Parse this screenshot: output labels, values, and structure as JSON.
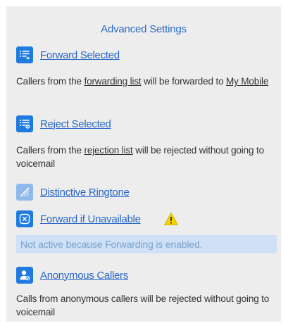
{
  "header": {
    "title": "Advanced Settings"
  },
  "forward_selected": {
    "label": "Forward Selected",
    "desc_before": "Callers from the ",
    "desc_link": "forwarding list",
    "desc_middle": " will be forwarded to ",
    "desc_target": "My Mobile",
    "icon": "list-forward-icon"
  },
  "reject_selected": {
    "label": "Reject Selected",
    "desc_before": "Callers from the ",
    "desc_link": "rejection list",
    "desc_after": " will be rejected without going to voicemail",
    "icon": "list-reject-icon"
  },
  "distinctive_ringtone": {
    "label": "Distinctive Ringtone",
    "icon": "ringtone-icon"
  },
  "forward_if_unavailable": {
    "label": "Forward if Unavailable",
    "icon": "forward-unavailable-icon",
    "warning_icon": "warning-icon",
    "notice": "Not active because Forwarding is enabled."
  },
  "anonymous_callers": {
    "label": "Anonymous Callers",
    "desc": "Calls from anonymous callers will be rejected without going to voicemail",
    "icon": "anonymous-caller-icon"
  },
  "colors": {
    "accent": "#1f7be0",
    "link": "#2867c8",
    "panel_bg": "#ededed",
    "notice_bg": "#cfe1f6",
    "warning": "#f5d300"
  }
}
